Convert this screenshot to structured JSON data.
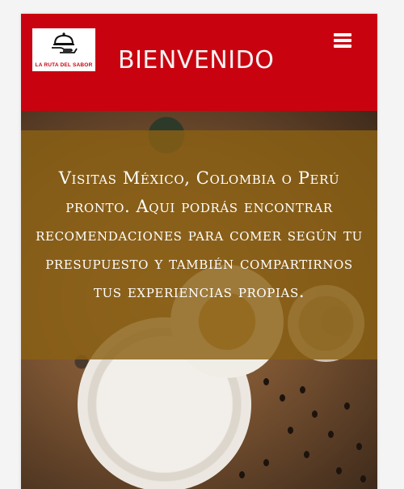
{
  "header": {
    "logo": {
      "icon": "serving-cloche-hand-icon",
      "text": "LA RUTA DEL SABOR"
    },
    "title": "BIENVENIDO",
    "menu_icon": "hamburger-menu-icon"
  },
  "hero": {
    "message": "Visitas México, Colombia o Perú pronto. Aqui podrás encontrar recomendaciones para comer según tu presupuesto y también compartirnos tus experiencias propias."
  },
  "colors": {
    "brand_red": "#c8030f",
    "overlay": "#8a6014",
    "text_on_dark": "#ffffff"
  }
}
